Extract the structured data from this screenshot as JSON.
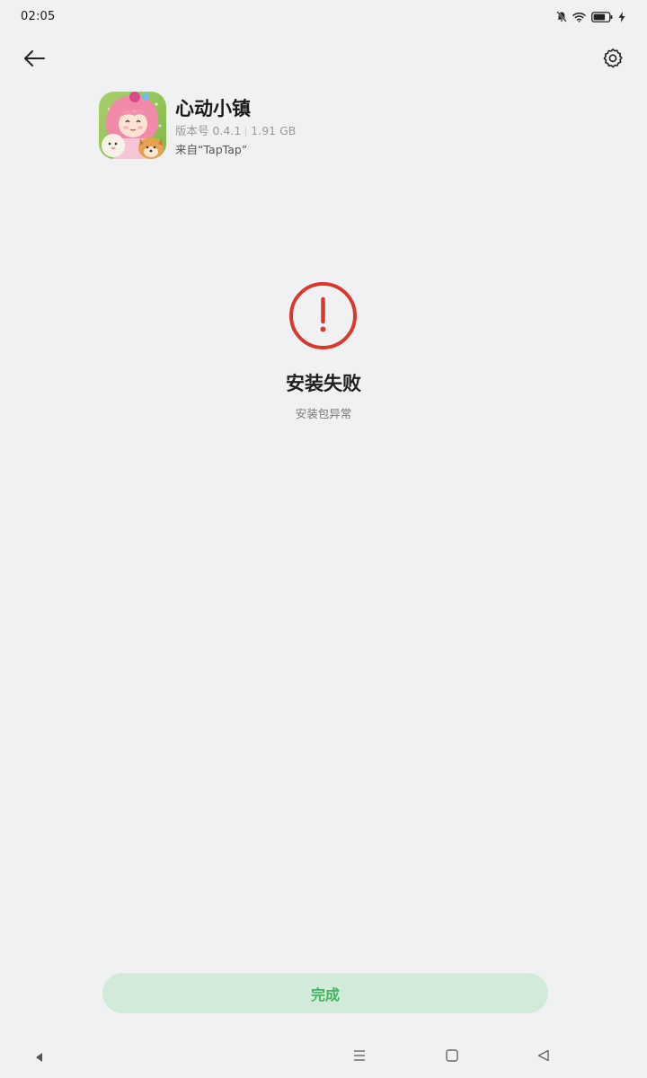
{
  "status_bar": {
    "time": "02:05",
    "icons": [
      "mute-icon",
      "wifi-icon",
      "battery-icon",
      "charging-icon"
    ]
  },
  "header": {
    "back_icon": "arrow-left-icon",
    "settings_icon": "gear-icon"
  },
  "app": {
    "name": "心动小镇",
    "version_label": "版本号 0.4.1",
    "size": "1.91 GB",
    "source": "来自“TapTap”"
  },
  "result": {
    "icon": "error-exclamation-icon",
    "title": "安装失败",
    "subtitle": "安装包异常",
    "accent_color": "#d9392c"
  },
  "actions": {
    "done_label": "完成",
    "done_text_color": "#3cb55c",
    "done_bg_color": "#d2ead9"
  },
  "nav_bar": {
    "icons": [
      "triangle-left-small-icon",
      "menu-icon",
      "home-square-icon",
      "back-triangle-icon"
    ]
  }
}
